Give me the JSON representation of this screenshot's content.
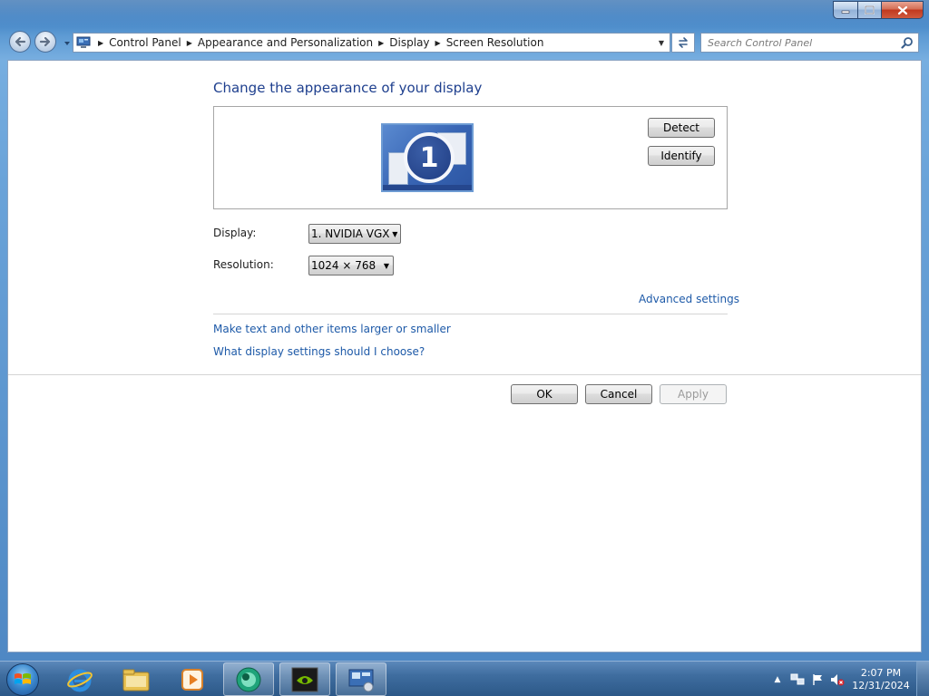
{
  "window": {
    "minimize_icon": "minimize-icon",
    "maximize_icon": "maximize-icon",
    "close_icon": "close-icon"
  },
  "nav": {
    "back_icon": "back-arrow-icon",
    "forward_icon": "forward-arrow-icon",
    "breadcrumbs": [
      "Control Panel",
      "Appearance and Personalization",
      "Display",
      "Screen Resolution"
    ],
    "search_placeholder": "Search Control Panel"
  },
  "main": {
    "heading": "Change the appearance of your display",
    "monitor_number": "1",
    "detect_label": "Detect",
    "identify_label": "Identify",
    "display_label": "Display:",
    "display_value": "1. NVIDIA VGX",
    "resolution_label": "Resolution:",
    "resolution_value": "1024 × 768",
    "advanced_link": "Advanced settings",
    "larger_text_link": "Make text and other items larger or smaller",
    "which_settings_link": "What display settings should I choose?",
    "ok_label": "OK",
    "cancel_label": "Cancel",
    "apply_label": "Apply"
  },
  "taskbar": {
    "pinned": [
      "internet-explorer-icon",
      "file-explorer-icon",
      "media-player-icon",
      "app-green-icon",
      "nvidia-icon",
      "display-settings-icon"
    ],
    "clock_time": "2:07 PM",
    "clock_date": "12/31/2024"
  },
  "colors": {
    "link": "#1e5aa8",
    "heading": "#1e3f8e",
    "glass": "#5e9bd4"
  }
}
